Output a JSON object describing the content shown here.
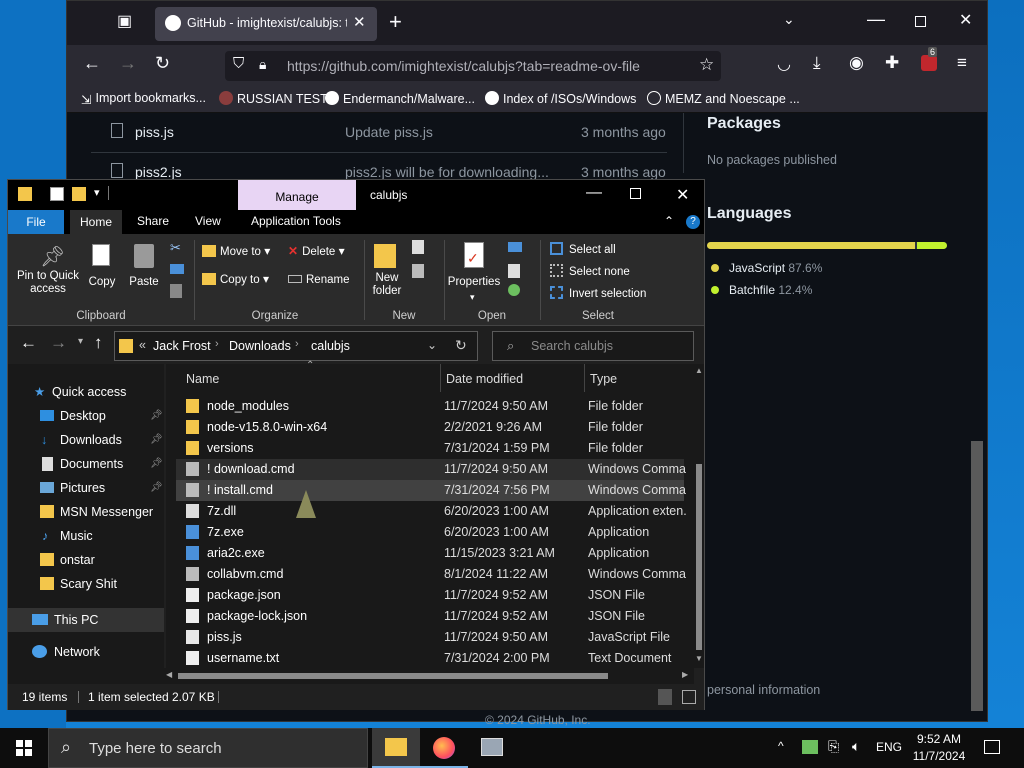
{
  "browser": {
    "tab_title": "GitHub - imightexist/calubjs: th",
    "url": "https://github.com/imightexist/calubjs?tab=readme-ov-file",
    "badge_count": "6",
    "bookmarks": [
      "Import bookmarks...",
      "RUSSIAN TEST",
      "Endermanch/Malware...",
      "Index of /ISOs/Windows",
      "MEMZ and Noescape ..."
    ]
  },
  "github": {
    "files": [
      {
        "name": "piss.js",
        "message": "Update piss.js",
        "age": "3 months ago"
      },
      {
        "name": "piss2.js",
        "message": "piss2.js will be for downloading...",
        "age": "3 months ago"
      }
    ],
    "packages_title": "Packages",
    "packages_text": "No packages published",
    "languages_title": "Languages",
    "languages": [
      {
        "name": "JavaScript",
        "percent": "87.6%",
        "color": "#e3d44c",
        "fraction": 0.876
      },
      {
        "name": "Batchfile",
        "percent": "12.4%",
        "color": "#c1f12e",
        "fraction": 0.124
      }
    ],
    "footer_partial": "personal information",
    "copyright": "© 2024 GitHub, Inc."
  },
  "explorer": {
    "manage_label": "Manage",
    "window_title": "calubjs",
    "ribbon_tabs": [
      "File",
      "Home",
      "Share",
      "View",
      "Application Tools"
    ],
    "clipboard": {
      "pin": "Pin to Quick access",
      "copy": "Copy",
      "paste": "Paste",
      "group": "Clipboard"
    },
    "organize": {
      "move_to": "Move to",
      "copy_to": "Copy to",
      "delete": "Delete",
      "rename": "Rename",
      "group": "Organize"
    },
    "new": {
      "new_folder": "New folder",
      "group": "New"
    },
    "open": {
      "properties": "Properties",
      "group": "Open"
    },
    "select": {
      "select_all": "Select all",
      "select_none": "Select none",
      "invert": "Invert selection",
      "group": "Select"
    },
    "breadcrumb": [
      "Jack Frost",
      "Downloads",
      "calubjs"
    ],
    "breadcrumb_prefix": "«",
    "search_placeholder": "Search calubjs",
    "columns": {
      "name": "Name",
      "date": "Date modified",
      "type": "Type"
    },
    "nav": [
      {
        "label": "Quick access",
        "icon": "star-icon"
      },
      {
        "label": "Desktop",
        "icon": "desktop-icon",
        "pinned": true
      },
      {
        "label": "Downloads",
        "icon": "download-icon",
        "pinned": true
      },
      {
        "label": "Documents",
        "icon": "document-icon",
        "pinned": true
      },
      {
        "label": "Pictures",
        "icon": "picture-icon",
        "pinned": true
      },
      {
        "label": "MSN Messenger",
        "icon": "folder-icon"
      },
      {
        "label": "Music",
        "icon": "music-icon"
      },
      {
        "label": "onstar",
        "icon": "folder-icon"
      },
      {
        "label": "Scary Shit",
        "icon": "folder-icon"
      },
      {
        "label": "This PC",
        "icon": "pc-icon"
      },
      {
        "label": "Network",
        "icon": "network-icon"
      }
    ],
    "files": [
      {
        "name": "node_modules",
        "date": "11/7/2024 9:50 AM",
        "type": "File folder",
        "icon": "folder-icon"
      },
      {
        "name": "node-v15.8.0-win-x64",
        "date": "2/2/2021 9:26 AM",
        "type": "File folder",
        "icon": "folder-icon"
      },
      {
        "name": "versions",
        "date": "7/31/2024 1:59 PM",
        "type": "File folder",
        "icon": "folder-icon"
      },
      {
        "name": "! download.cmd",
        "date": "11/7/2024 9:50 AM",
        "type": "Windows Comma...",
        "icon": "cmd-icon"
      },
      {
        "name": "! install.cmd",
        "date": "7/31/2024 7:56 PM",
        "type": "Windows Comma...",
        "icon": "cmd-icon"
      },
      {
        "name": "7z.dll",
        "date": "6/20/2023 1:00 AM",
        "type": "Application exten...",
        "icon": "dll-icon"
      },
      {
        "name": "7z.exe",
        "date": "6/20/2023 1:00 AM",
        "type": "Application",
        "icon": "exe-icon"
      },
      {
        "name": "aria2c.exe",
        "date": "11/15/2023 3:21 AM",
        "type": "Application",
        "icon": "exe-icon"
      },
      {
        "name": "collabvm.cmd",
        "date": "8/1/2024 11:22 AM",
        "type": "Windows Comma...",
        "icon": "cmd-icon"
      },
      {
        "name": "package.json",
        "date": "11/7/2024 9:52 AM",
        "type": "JSON File",
        "icon": "file-icon"
      },
      {
        "name": "package-lock.json",
        "date": "11/7/2024 9:52 AM",
        "type": "JSON File",
        "icon": "file-icon"
      },
      {
        "name": "piss.js",
        "date": "11/7/2024 9:50 AM",
        "type": "JavaScript File",
        "icon": "js-icon"
      },
      {
        "name": "username.txt",
        "date": "7/31/2024 2:00 PM",
        "type": "Text Document",
        "icon": "txt-icon"
      }
    ],
    "status": {
      "items": "19 items",
      "selected": "1 item selected",
      "size": "2.07 KB"
    }
  },
  "taskbar": {
    "search_placeholder": "Type here to search",
    "lang": "ENG",
    "time": "9:52 AM",
    "date": "11/7/2024"
  }
}
